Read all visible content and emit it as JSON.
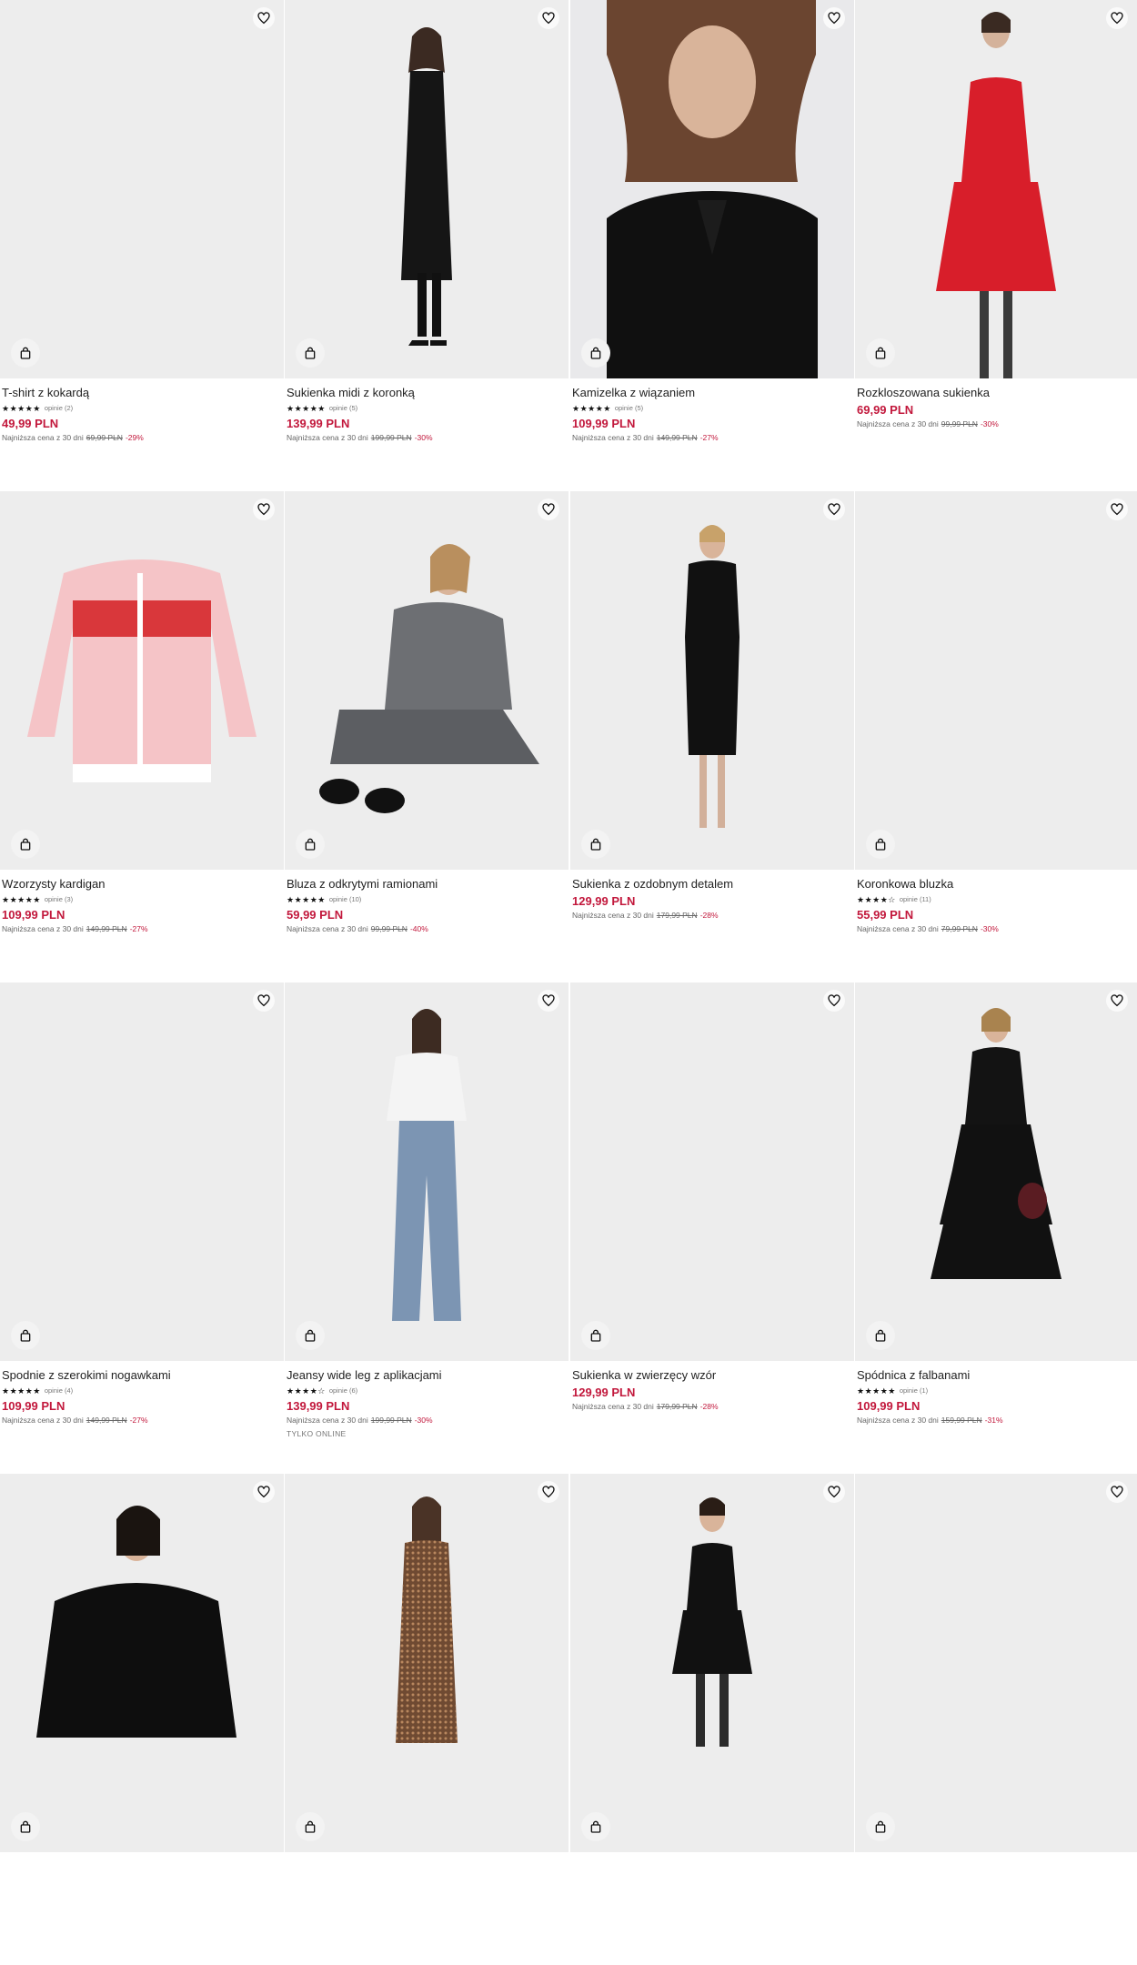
{
  "colors": {
    "price": "#c2183c",
    "discount": "#c2183c",
    "image_bg": "#ededed"
  },
  "icons": {
    "wishlist": "heart-outline-icon",
    "add_to_cart": "shopping-bag-icon",
    "rating": "star-icon"
  },
  "products": [
    {
      "name": "T-shirt z kokardą",
      "stars": "★★★★★",
      "reviews": "opinie (2)",
      "price": "49,99 PLN",
      "lowest_label": "Najniższa cena z 30 dni",
      "old_price": "69,99 PLN",
      "discount": "-29%",
      "badge": "",
      "image": "blank"
    },
    {
      "name": "Sukienka midi z koronką",
      "stars": "★★★★★",
      "reviews": "opinie (5)",
      "price": "139,99 PLN",
      "lowest_label": "Najniższa cena z 30 dni",
      "old_price": "199,99 PLN",
      "discount": "-30%",
      "badge": "",
      "image": "black-long-dress"
    },
    {
      "name": "Kamizelka z wiązaniem",
      "stars": "★★★★★",
      "reviews": "opinie (5)",
      "price": "109,99 PLN",
      "lowest_label": "Najniższa cena z 30 dni",
      "old_price": "149,99 PLN",
      "discount": "-27%",
      "badge": "",
      "image": "black-vest-closeup"
    },
    {
      "name": "Rozkloszowana sukienka",
      "stars": "",
      "reviews": "",
      "price": "69,99 PLN",
      "lowest_label": "Najniższa cena z 30 dni",
      "old_price": "99,99 PLN",
      "discount": "-30%",
      "badge": "",
      "image": "red-dress"
    },
    {
      "name": "Wzorzysty kardigan",
      "stars": "★★★★★",
      "reviews": "opinie (3)",
      "price": "109,99 PLN",
      "lowest_label": "Najniższa cena z 30 dni",
      "old_price": "149,99 PLN",
      "discount": "-27%",
      "badge": "",
      "image": "pink-cardigan"
    },
    {
      "name": "Bluza z odkrytymi ramionami",
      "stars": "★★★★★",
      "reviews": "opinie (10)",
      "price": "59,99 PLN",
      "lowest_label": "Najniższa cena z 30 dni",
      "old_price": "99,99 PLN",
      "discount": "-40%",
      "badge": "",
      "image": "grey-sweater-sitting"
    },
    {
      "name": "Sukienka z ozdobnym detalem",
      "stars": "",
      "reviews": "",
      "price": "129,99 PLN",
      "lowest_label": "Najniższa cena z 30 dni",
      "old_price": "179,99 PLN",
      "discount": "-28%",
      "badge": "",
      "image": "black-midi-dress"
    },
    {
      "name": "Koronkowa bluzka",
      "stars": "★★★★☆",
      "reviews": "opinie (11)",
      "price": "55,99 PLN",
      "lowest_label": "Najniższa cena z 30 dni",
      "old_price": "79,99 PLN",
      "discount": "-30%",
      "badge": "",
      "image": "blank"
    },
    {
      "name": "Spodnie z szerokimi nogawkami",
      "stars": "★★★★★",
      "reviews": "opinie (4)",
      "price": "109,99 PLN",
      "lowest_label": "Najniższa cena z 30 dni",
      "old_price": "149,99 PLN",
      "discount": "-27%",
      "badge": "",
      "image": "blank"
    },
    {
      "name": "Jeansy wide leg z aplikacjami",
      "stars": "★★★★☆",
      "reviews": "opinie (6)",
      "price": "139,99 PLN",
      "lowest_label": "Najniższa cena z 30 dni",
      "old_price": "199,99 PLN",
      "discount": "-30%",
      "badge": "TYLKO ONLINE",
      "image": "jeans-white-tee"
    },
    {
      "name": "Sukienka w zwierzęcy wzór",
      "stars": "",
      "reviews": "",
      "price": "129,99 PLN",
      "lowest_label": "Najniższa cena z 30 dni",
      "old_price": "179,99 PLN",
      "discount": "-28%",
      "badge": "",
      "image": "blank"
    },
    {
      "name": "Spódnica z falbanami",
      "stars": "★★★★★",
      "reviews": "opinie (1)",
      "price": "109,99 PLN",
      "lowest_label": "Najniższa cena z 30 dni",
      "old_price": "159,99 PLN",
      "discount": "-31%",
      "badge": "",
      "image": "black-tiered-skirt"
    },
    {
      "name": "",
      "stars": "",
      "reviews": "",
      "price": "",
      "lowest_label": "",
      "old_price": "",
      "discount": "",
      "badge": "",
      "image": "black-knit-sweater"
    },
    {
      "name": "",
      "stars": "",
      "reviews": "",
      "price": "",
      "lowest_label": "",
      "old_price": "",
      "discount": "",
      "badge": "",
      "image": "sequin-dress"
    },
    {
      "name": "",
      "stars": "",
      "reviews": "",
      "price": "",
      "lowest_label": "",
      "old_price": "",
      "discount": "",
      "badge": "",
      "image": "black-mini-dress-boots"
    },
    {
      "name": "",
      "stars": "",
      "reviews": "",
      "price": "",
      "lowest_label": "",
      "old_price": "",
      "discount": "",
      "badge": "",
      "image": "blank"
    }
  ]
}
